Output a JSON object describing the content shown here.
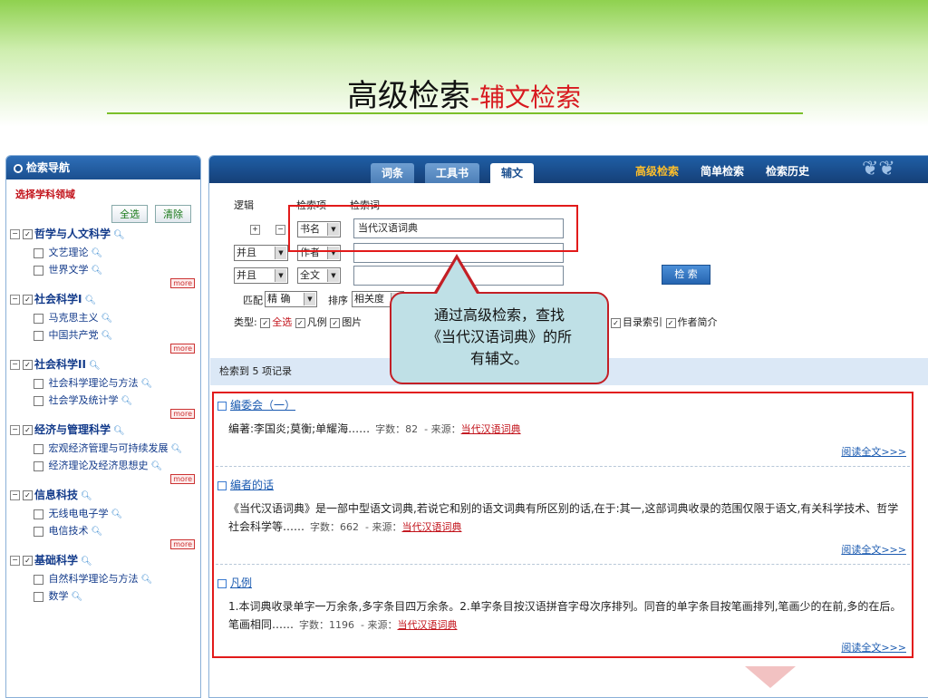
{
  "slide": {
    "title_main": "高级检索",
    "title_sub": "-辅文检索"
  },
  "sidebar": {
    "header": "检索导航",
    "select_label": "选择学科领域",
    "select_all": "全选",
    "clear": "清除",
    "more": "more",
    "categories": [
      {
        "name": "哲学与人文科学",
        "items": [
          "文艺理论",
          "世界文学"
        ]
      },
      {
        "name": "社会科学I",
        "items": [
          "马克思主义",
          "中国共产党"
        ]
      },
      {
        "name": "社会科学II",
        "items": [
          "社会科学理论与方法",
          "社会学及统计学"
        ]
      },
      {
        "name": "经济与管理科学",
        "items": [
          "宏观经济管理与可持续发展",
          "经济理论及经济思想史"
        ]
      },
      {
        "name": "信息科技",
        "items": [
          "无线电电子学",
          "电信技术"
        ]
      },
      {
        "name": "基础科学",
        "items": [
          "自然科学理论与方法",
          "数学"
        ]
      }
    ]
  },
  "topbar": {
    "tabs": [
      "词条",
      "工具书",
      "辅文"
    ],
    "active_tab": "辅文",
    "links": [
      "高级检索",
      "简单检索",
      "检索历史"
    ]
  },
  "form": {
    "col_logic": "逻辑",
    "col_field": "检索项",
    "col_term": "检索词",
    "rows": [
      {
        "logic": "",
        "field": "书名",
        "value": "当代汉语词典"
      },
      {
        "logic": "并且",
        "field": "作者",
        "value": ""
      },
      {
        "logic": "并且",
        "field": "全文",
        "value": ""
      }
    ],
    "match_label": "匹配",
    "match_value": "精 确",
    "sort_label": "排序",
    "sort_value": "相关度",
    "search_button": "检 索",
    "types_label": "类型:",
    "types": [
      "全选",
      "凡例",
      "图片",
      "目录索引",
      "作者简介"
    ]
  },
  "callout": {
    "text_lines": [
      "通过高级检索，查找",
      "《当代汉语词典》的所",
      "有辅文。"
    ]
  },
  "results": {
    "count_text": "检索到 5 项记录",
    "read_all": "阅读全文>>>",
    "source_label": "- 来源：",
    "items": [
      {
        "title": "编委会（一）",
        "body": "编著:李国炎;莫衡;单耀海……",
        "words": "字数：82",
        "source": "当代汉语词典"
      },
      {
        "title": "编者的话",
        "body": "《当代汉语词典》是一部中型语文词典,若说它和别的语文词典有所区别的话,在于:其一,这部词典收录的范围仅限于语文,有关科学技术、哲学社会科学等……",
        "words": "字数：662",
        "source": "当代汉语词典"
      },
      {
        "title": "凡例",
        "body": "1.本词典收录单字一万余条,多字条目四万余条。2.单字条目按汉语拼音字母次序排列。同音的单字条目按笔画排列,笔画少的在前,多的在后。笔画相同……",
        "words": "字数：1196",
        "source": "当代汉语词典"
      }
    ]
  },
  "colors": {
    "accent_red": "#e21a1a",
    "nav_blue": "#1b4f8f",
    "green_band": "#8fd14f",
    "callout_fill": "#bfe0e6"
  }
}
